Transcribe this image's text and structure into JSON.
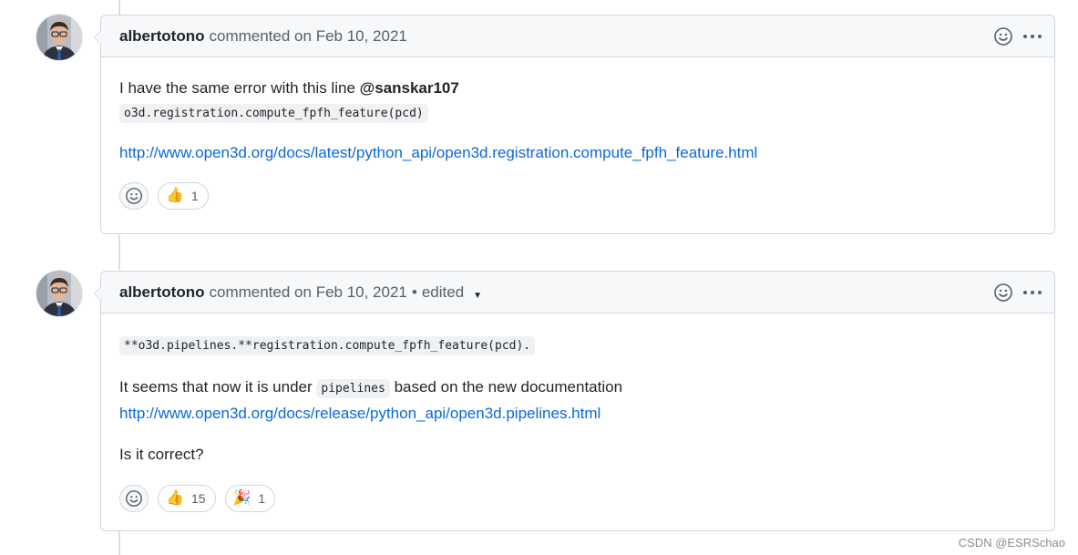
{
  "comments": [
    {
      "author": "albertotono",
      "action": "commented on",
      "date": "Feb 10, 2021",
      "edited": "",
      "body": {
        "line1_text": "I have the same error with this line ",
        "mention": "@sanskar107",
        "code": "o3d.registration.compute_fpfh_feature(pcd)",
        "link": "http://www.open3d.org/docs/latest/python_api/open3d.registration.compute_fpfh_feature.html"
      },
      "reactions": [
        {
          "icon": "thumbs-up-icon",
          "emoji": "👍",
          "count": "1"
        }
      ]
    },
    {
      "author": "albertotono",
      "action": "commented on",
      "date": "Feb 10, 2021",
      "separator": "•",
      "edited": "edited",
      "body": {
        "code_block": "**o3d.pipelines.**registration.compute_fpfh_feature(pcd).",
        "text_before_code": "It seems that now it is under ",
        "inline_code": "pipelines",
        "text_after_code": " based on the new documentation",
        "link": "http://www.open3d.org/docs/release/python_api/open3d.pipelines.html",
        "question": "Is it correct?"
      },
      "reactions": [
        {
          "icon": "thumbs-up-icon",
          "emoji": "👍",
          "count": "15"
        },
        {
          "icon": "tada-icon",
          "emoji": "🎉",
          "count": "1"
        }
      ]
    }
  ],
  "watermark": "CSDN @ESRSchao",
  "colors": {
    "link": "#0969da",
    "border": "#d0d7de",
    "header_bg": "#f6f8fa"
  }
}
